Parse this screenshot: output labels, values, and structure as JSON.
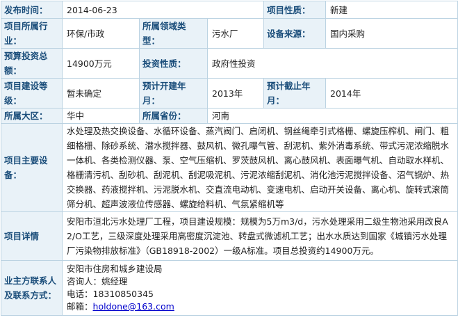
{
  "labels": {
    "publish_time": "发布时间：",
    "project_nature": "项目性质：",
    "industry": "项目所属行业：",
    "domain_type": "所属领域类型：",
    "equipment_source": "设备来源：",
    "budget": "预算投资总额：",
    "investment_nature": "投资性质：",
    "construction_stage": "项目建设等级：",
    "planned_start": "预计开建年月：",
    "planned_end": "预计截止年月：",
    "region": "所属大区：",
    "province": "所属省份：",
    "main_equipment": "项目主要设备：",
    "details": "项目详情",
    "contact": "业主方联系人及联系方式："
  },
  "values": {
    "publish_time": "2014-06-23",
    "project_nature": "新建",
    "industry": "环保/市政",
    "domain_type": "污水厂",
    "equipment_source": "国内采购",
    "budget": "14900万元",
    "investment_nature": "政府性投资",
    "construction_stage": "暂未确定",
    "planned_start": "2013年",
    "planned_end": "2014年",
    "region": "华中",
    "province": "河南",
    "main_equipment": "水处理及热交换设备、水循环设备、蒸汽阀门、启闭机、钢丝绳牵引式格栅、螺旋压榨机、闸门、粗细格栅、除砂系统、潜水搅拌器、鼓风机、微孔曝气管、刮泥机、紫外消毒系统、带式污泥浓缩脱水一体机、各类检测仪器、泵、空气压缩机、罗茨鼓风机、离心鼓风机、表面曝气机、自动取水样机、格栅清污机、刮砂机、刮泥机、刮泥吸泥机、污泥浓缩刮泥机、消化池污泥搅拌设备、沼气锅炉、热交换器、药液搅拌机、污泥脱水机、交直流电动机、变速电机、启动开关设备、离心机、旋转式滚筒筛分机、超声波液位传感器、螺旋给料机、气氛紧缩机等",
    "details": "安阳市洹北污水处理厂工程，项目建设规模：规模为5万m3/d，污水处理采用二级生物池采用改良A2/O工艺，三级深度处理采用高密度沉淀池、转盘式微滤机工艺；出水水质达到国家《城镇污水处理厂污染物排放标准》（GB18918-2002）一级A标准。项目总投资约14900万元。",
    "contact_org": "安阳市住房和城乡建设局",
    "contact_person": "咨询人：姚经理",
    "contact_phone": "电话：18310850345",
    "contact_email_label": "邮箱：",
    "contact_email": "holdone@163.com"
  }
}
